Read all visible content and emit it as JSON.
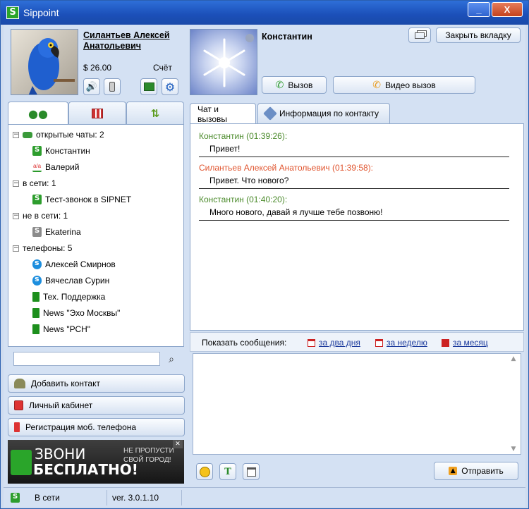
{
  "window": {
    "title": "Sippoint",
    "minimize": "_",
    "close": "X"
  },
  "user": {
    "name": "Силантьев Алексей Анатольевич",
    "balance": "$ 26.00",
    "account_label": "Счёт"
  },
  "contact": {
    "name": "Константин"
  },
  "header_buttons": {
    "close_tab": "Закрыть вкладку",
    "call": "Вызов",
    "video_call": "Видео вызов"
  },
  "contact_tabs": {
    "chat": "Чат и вызовы",
    "info": "Информация по контакту"
  },
  "tree": {
    "groups": [
      {
        "label": "открытые чаты: 2",
        "items": [
          {
            "name": "Константин",
            "icon": "sippoint-online-icon"
          },
          {
            "name": "Валерий",
            "icon": "icq-icon"
          }
        ]
      },
      {
        "label": "в сети: 1",
        "items": [
          {
            "name": "Тест-звонок в SIPNET",
            "icon": "sippoint-online-icon"
          }
        ]
      },
      {
        "label": "не в сети: 1",
        "items": [
          {
            "name": "Ekaterina",
            "icon": "sippoint-offline-icon"
          }
        ]
      },
      {
        "label": "телефоны: 5",
        "items": [
          {
            "name": "Алексей Смирнов",
            "icon": "skype-icon"
          },
          {
            "name": "Вячеслав Сурин",
            "icon": "skype-icon"
          },
          {
            "name": "Тех. Поддержка",
            "icon": "phone-icon"
          },
          {
            "name": "News \"Эхо Москвы\"",
            "icon": "phone-icon"
          },
          {
            "name": "News \"РСН\"",
            "icon": "phone-icon"
          }
        ]
      }
    ]
  },
  "left_buttons": {
    "add_contact": "Добавить контакт",
    "cabinet": "Личный кабинет",
    "register_phone": "Регистрация  моб. телефона"
  },
  "banner": {
    "line1": "ЗВОНИ",
    "line2": "БЕСПЛАТНО!",
    "side1": "НЕ ПРОПУСТИ",
    "side2": "СВОЙ ГОРОД!",
    "close": "✕"
  },
  "messages": [
    {
      "header": "Константин (01:39:26):",
      "text": "Привет!",
      "color": "#4a8a2a"
    },
    {
      "header": "Силантьев Алексей Анатольевич (01:39:58):",
      "text": "Привет. Что нового?",
      "color": "#e0542e"
    },
    {
      "header": "Константин (01:40:20):",
      "text": "Много нового, давай я лучше тебе позвоню!",
      "color": "#4a8a2a"
    }
  ],
  "history": {
    "label": "Показать сообщения:",
    "two_days": "за два дня",
    "week": "за неделю",
    "month": "за месяц"
  },
  "send_button": "Отправить",
  "status": {
    "state": "В сети",
    "version": "ver. 3.0.1.10"
  }
}
